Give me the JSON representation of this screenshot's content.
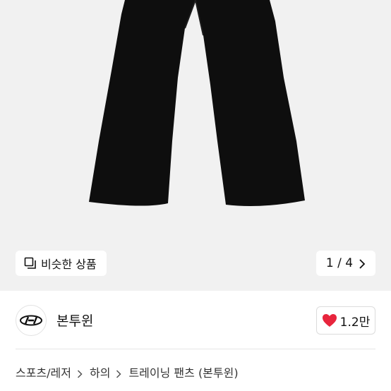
{
  "gallery": {
    "similar_label": "비슷한 상품",
    "pager": {
      "current": "1",
      "total": "4",
      "text": "1 / 4"
    }
  },
  "seller": {
    "name": "본투윈",
    "likes": "1.2만"
  },
  "breadcrumb": {
    "items": [
      "스포츠/레저",
      "하의",
      "트레이닝 팬츠 (본투윈)"
    ]
  },
  "colors": {
    "gallery_bg": "#f1f1f1",
    "product": "#0e0e0e",
    "heart": "#e8253d"
  },
  "icons": [
    "similar-items-icon",
    "chevron-right-icon",
    "brand-logo",
    "heart-icon"
  ]
}
